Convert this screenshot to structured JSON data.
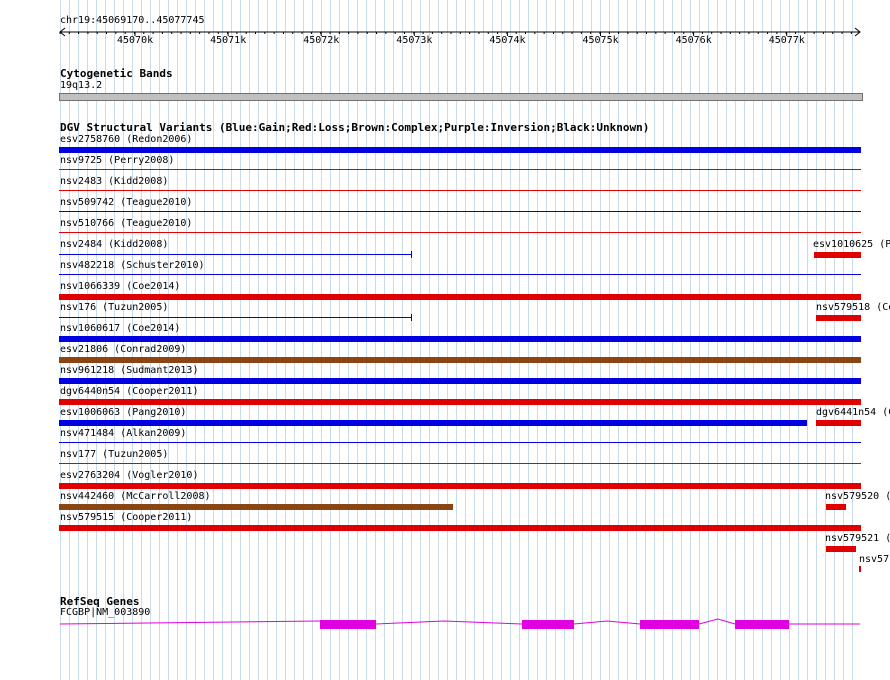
{
  "ruler": {
    "coords_label": "chr19:45069170..45077745",
    "ticks": [
      "45070k",
      "45071k",
      "45072k",
      "45073k",
      "45074k",
      "45075k",
      "45076k",
      "45077k"
    ]
  },
  "cyto": {
    "title": "Cytogenetic Bands",
    "band": "19q13.2"
  },
  "dgv": {
    "title": "DGV Structural Variants (Blue:Gain;Red:Loss;Brown:Complex;Purple:Inversion;Black:Unknown)",
    "labels": [
      "esv2758760 (Redon2006)",
      "nsv9725 (Perry2008)",
      "nsv2483 (Kidd2008)",
      "nsv509742 (Teague2010)",
      "nsv510766 (Teague2010)",
      "nsv2484 (Kidd2008)",
      "nsv482218 (Schuster2010)",
      "nsv1066339 (Coe2014)",
      "nsv176 (Tuzun2005)",
      "nsv1060617 (Coe2014)",
      "esv21806 (Conrad2009)",
      "nsv961218 (Sudmant2013)",
      "dgv6440n54 (Cooper2011)",
      "esv1006063 (Pang2010)",
      "nsv471484 (Alkan2009)",
      "nsv177 (Tuzun2005)",
      "esv2763204 (Vogler2010)",
      "nsv442460 (McCarroll2008)",
      "nsv579515 (Cooper2011)"
    ],
    "right_labels": [
      "esv1010625 (P",
      "nsv579518 (Co",
      "dgv6441n54 (C",
      "nsv579520 (",
      "nsv579521 (",
      "nsv57"
    ],
    "colors": {
      "gain": "#0000e0",
      "loss": "#e00000",
      "complex": "#8b4513"
    }
  },
  "refseq": {
    "title": "RefSeq Genes",
    "gene_label": "FCGBP|NM_003890",
    "color": "#e000e0"
  }
}
